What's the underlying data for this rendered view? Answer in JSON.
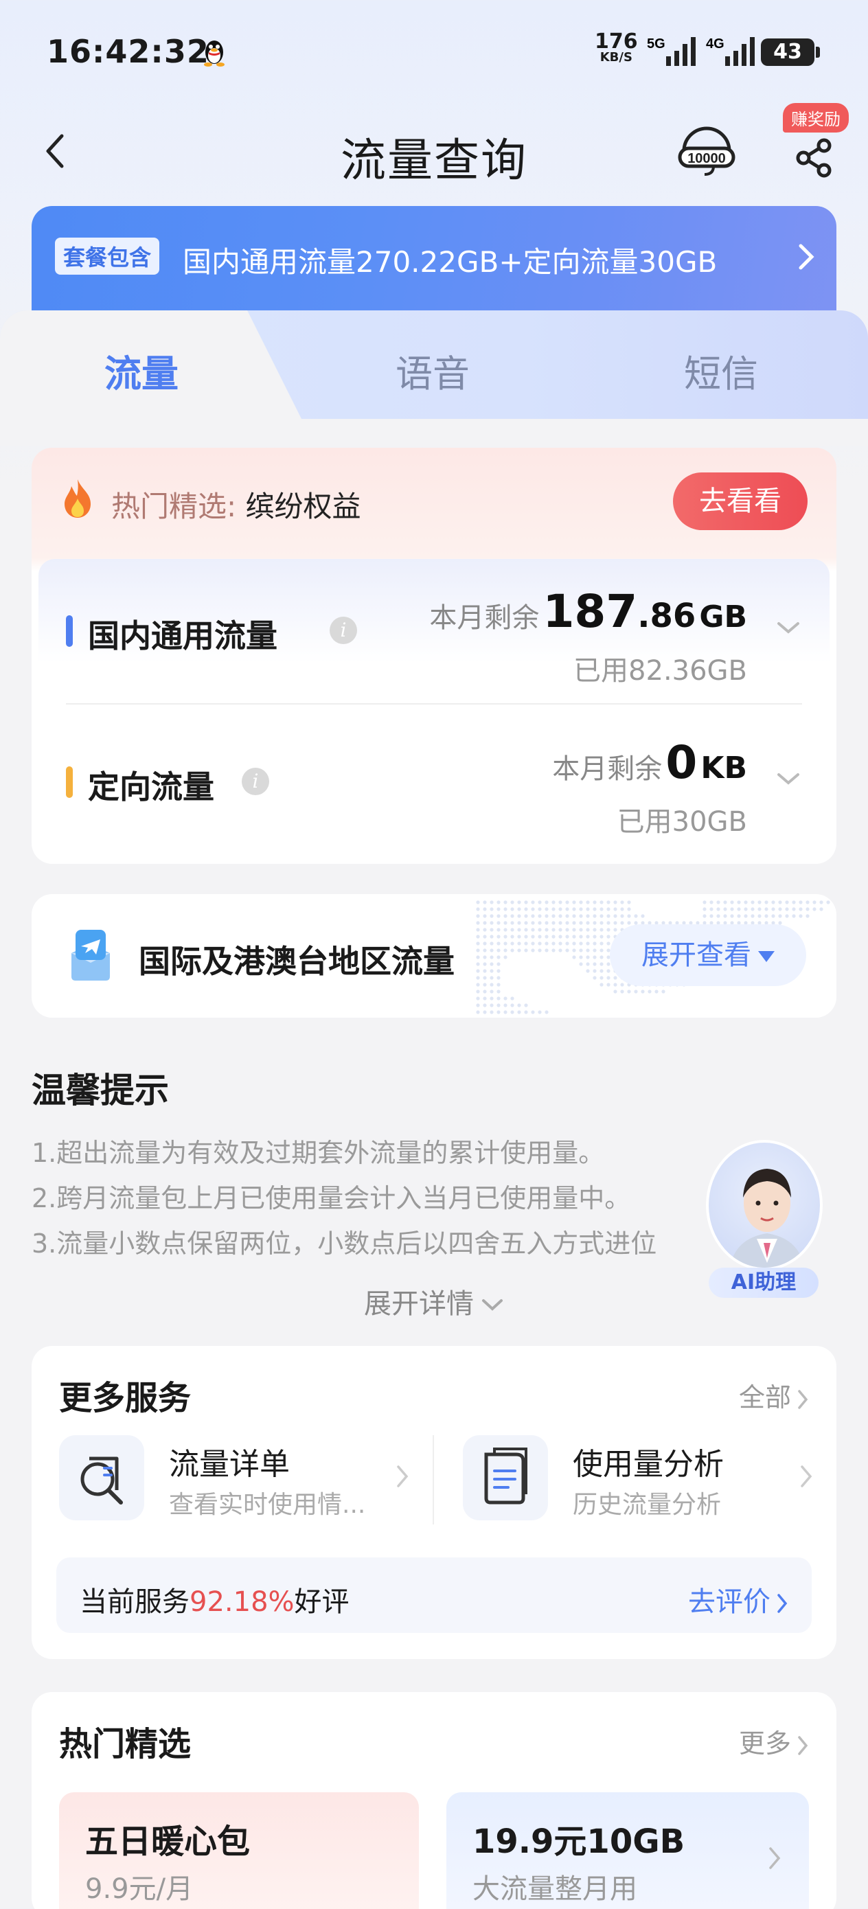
{
  "status_bar": {
    "time": "16:42:32",
    "speed_value": "176",
    "speed_unit": "KB/S",
    "net1": "5G",
    "net2": "4G",
    "battery": "43"
  },
  "header": {
    "title": "流量查询",
    "reward_badge": "赚奖励",
    "cs_icon_text": "10000"
  },
  "package": {
    "badge": "套餐包含",
    "text": "国内通用流量270.22GB+定向流量30GB"
  },
  "tabs": [
    {
      "label": "流量",
      "active": true
    },
    {
      "label": "语音",
      "active": false
    },
    {
      "label": "短信",
      "active": false
    }
  ],
  "hot_pick": {
    "label": "热门精选:",
    "value": "缤纷权益",
    "button": "去看看"
  },
  "usage": [
    {
      "name": "国内通用流量",
      "remain_label": "本月剩余",
      "remain_int": "187",
      "remain_dec": ".86",
      "unit": "GB",
      "used": "已用82.36GB",
      "bar_color": "#4f7ef0"
    },
    {
      "name": "定向流量",
      "remain_label": "本月剩余",
      "remain_int": "0",
      "remain_dec": "",
      "unit": "KB",
      "used": "已用30GB",
      "bar_color": "#f5b13d"
    }
  ],
  "intl": {
    "title": "国际及港澳台地区流量",
    "button": "展开查看"
  },
  "tips": {
    "title": "温馨提示",
    "lines": [
      "1.超出流量为有效及过期套外流量的累计使用量。",
      "2.跨月流量包上月已使用量会计入当月已使用量中。",
      "3.流量小数点保留两位，小数点后以四舍五入方式进位"
    ],
    "expand": "展开详情",
    "ai_label": "AI助理"
  },
  "services": {
    "title": "更多服务",
    "more": "全部",
    "items": [
      {
        "name": "流量详单",
        "sub": "查看实时使用情..."
      },
      {
        "name": "使用量分析",
        "sub": "历史流量分析"
      }
    ],
    "rating_prefix": "当前服务",
    "rating_pct": "92.18%",
    "rating_suffix": "好评",
    "rate_link": "去评价"
  },
  "picks": {
    "title": "热门精选",
    "more": "更多",
    "items": [
      {
        "title": "五日暖心包",
        "sub": "9.9元/月"
      },
      {
        "title": "19.9元10GB",
        "sub": "大流量整月用"
      }
    ]
  },
  "colors": {
    "accent": "#4f7ef0",
    "hot_red": "#ee4d55",
    "rating_red": "#e65050"
  }
}
